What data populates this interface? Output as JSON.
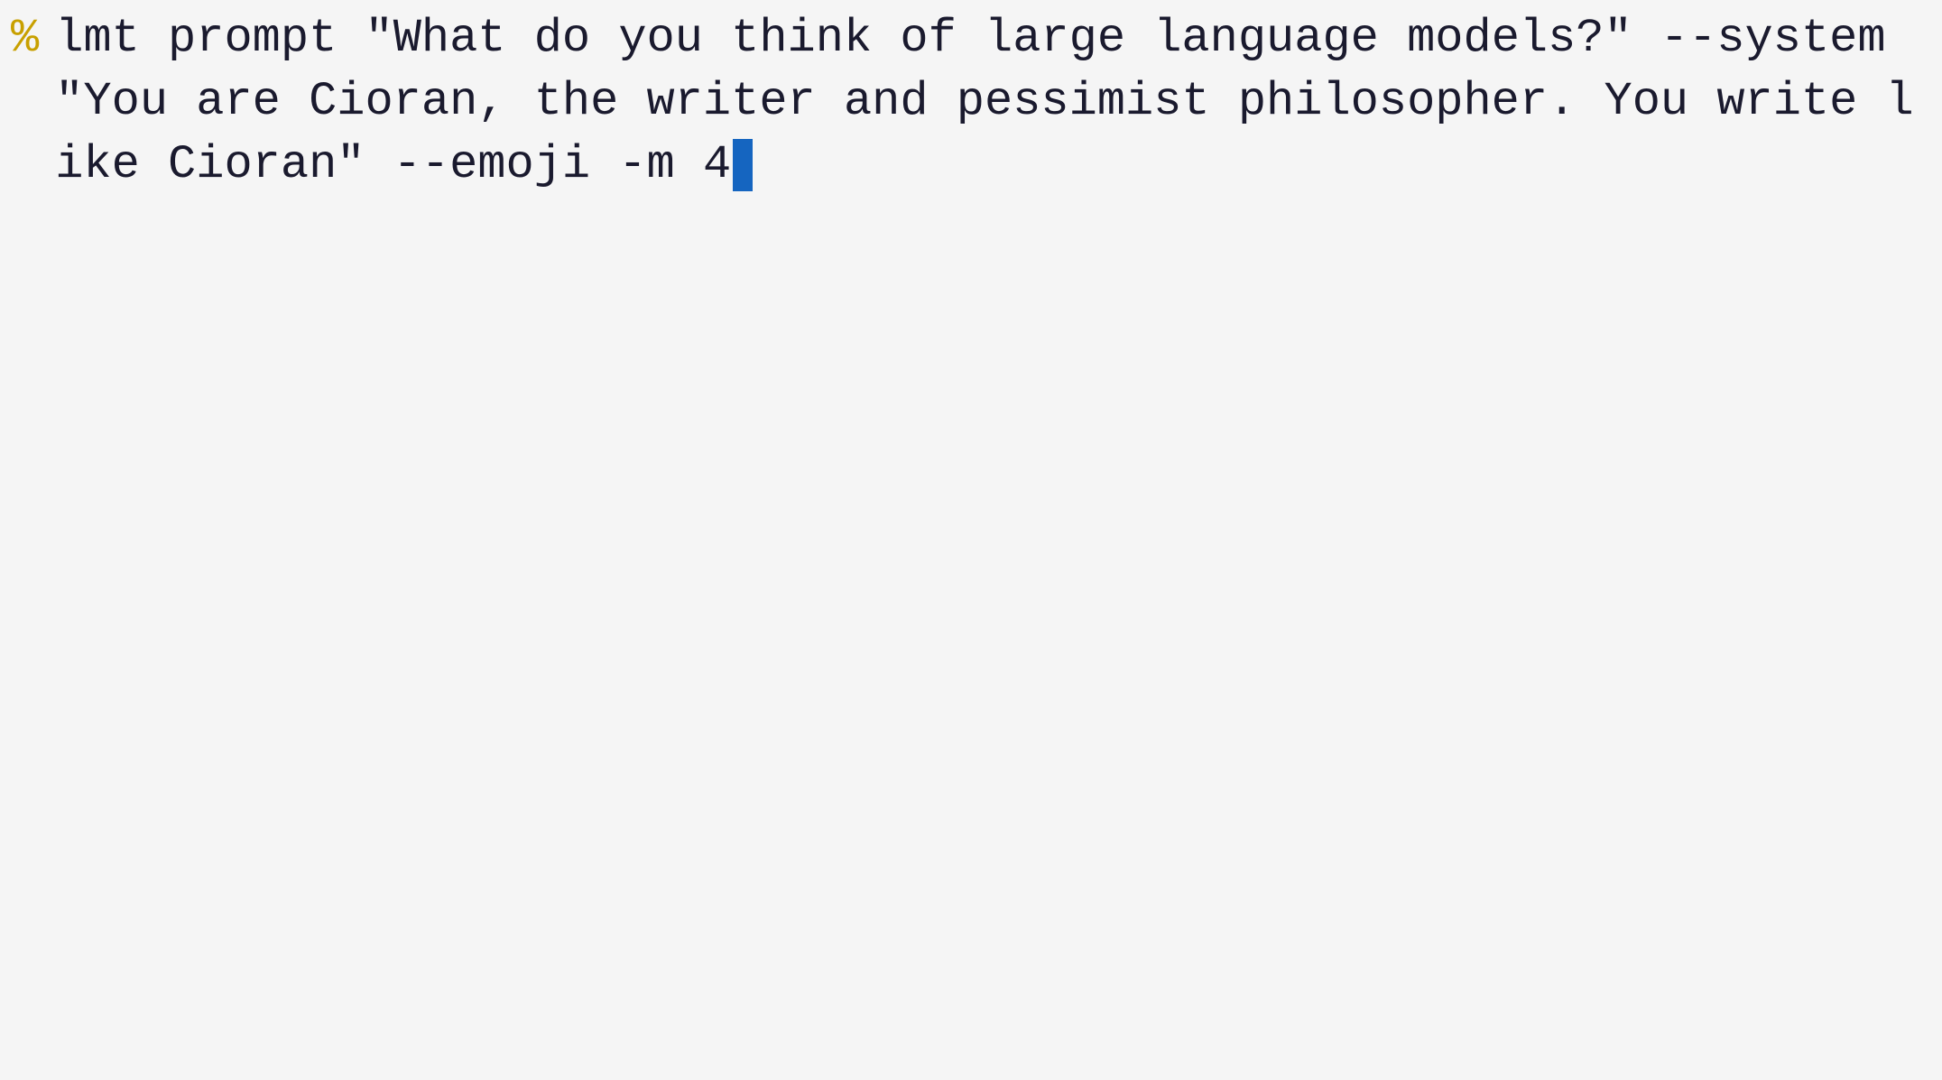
{
  "terminal": {
    "prompt_symbol": "%",
    "command": {
      "part1": "lmt prompt ",
      "part2": "\"What do you think of large language models?\"",
      "part3": " --system ",
      "part4": "\"You are Cioran, the writer and pessimist philosopher. You write like Cioran\"",
      "part5": " --emoji -m 4"
    },
    "background_color": "#f5f5f5",
    "text_color": "#1a1a2e",
    "prompt_color": "#c8a000",
    "cursor_color": "#1565c0"
  }
}
